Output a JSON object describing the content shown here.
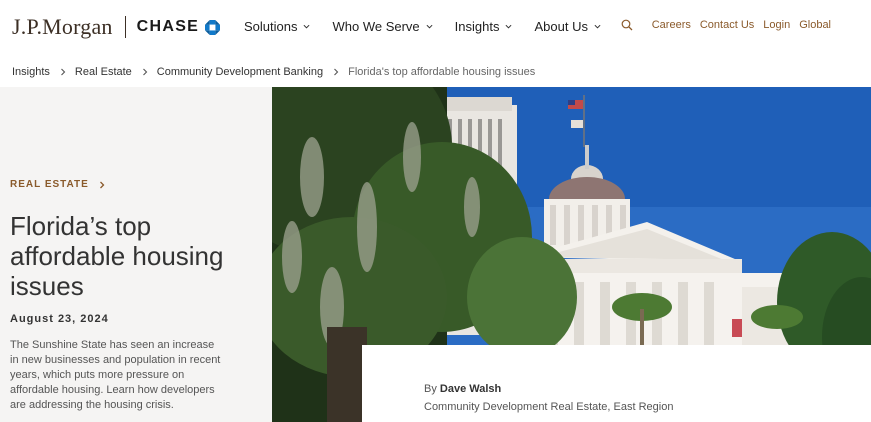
{
  "brand": {
    "primary": "J.P.Morgan",
    "secondary": "CHASE",
    "accent": "#8a5a2b",
    "chase_blue": "#117aca"
  },
  "nav": {
    "items": [
      {
        "label": "Solutions"
      },
      {
        "label": "Who We Serve"
      },
      {
        "label": "Insights"
      },
      {
        "label": "About Us"
      }
    ]
  },
  "utility": {
    "search_icon": "search-icon",
    "links": [
      "Careers",
      "Contact Us",
      "Login",
      "Global"
    ]
  },
  "breadcrumb": {
    "items": [
      "Insights",
      "Real Estate",
      "Community Development Banking",
      "Florida's top affordable housing issues"
    ]
  },
  "article": {
    "category": "REAL ESTATE",
    "title": "Florida’s top affordable housing issues",
    "date": "August 23, 2024",
    "description": "The Sunshine State has seen an increase in new businesses and population in recent years, which puts more pressure on affordable housing. Learn how developers are addressing the housing crisis.",
    "by_prefix": "By",
    "author": "Dave Walsh",
    "author_role": "Community Development Real Estate, East Region",
    "image_subject": "florida-state-capitol-photo"
  }
}
